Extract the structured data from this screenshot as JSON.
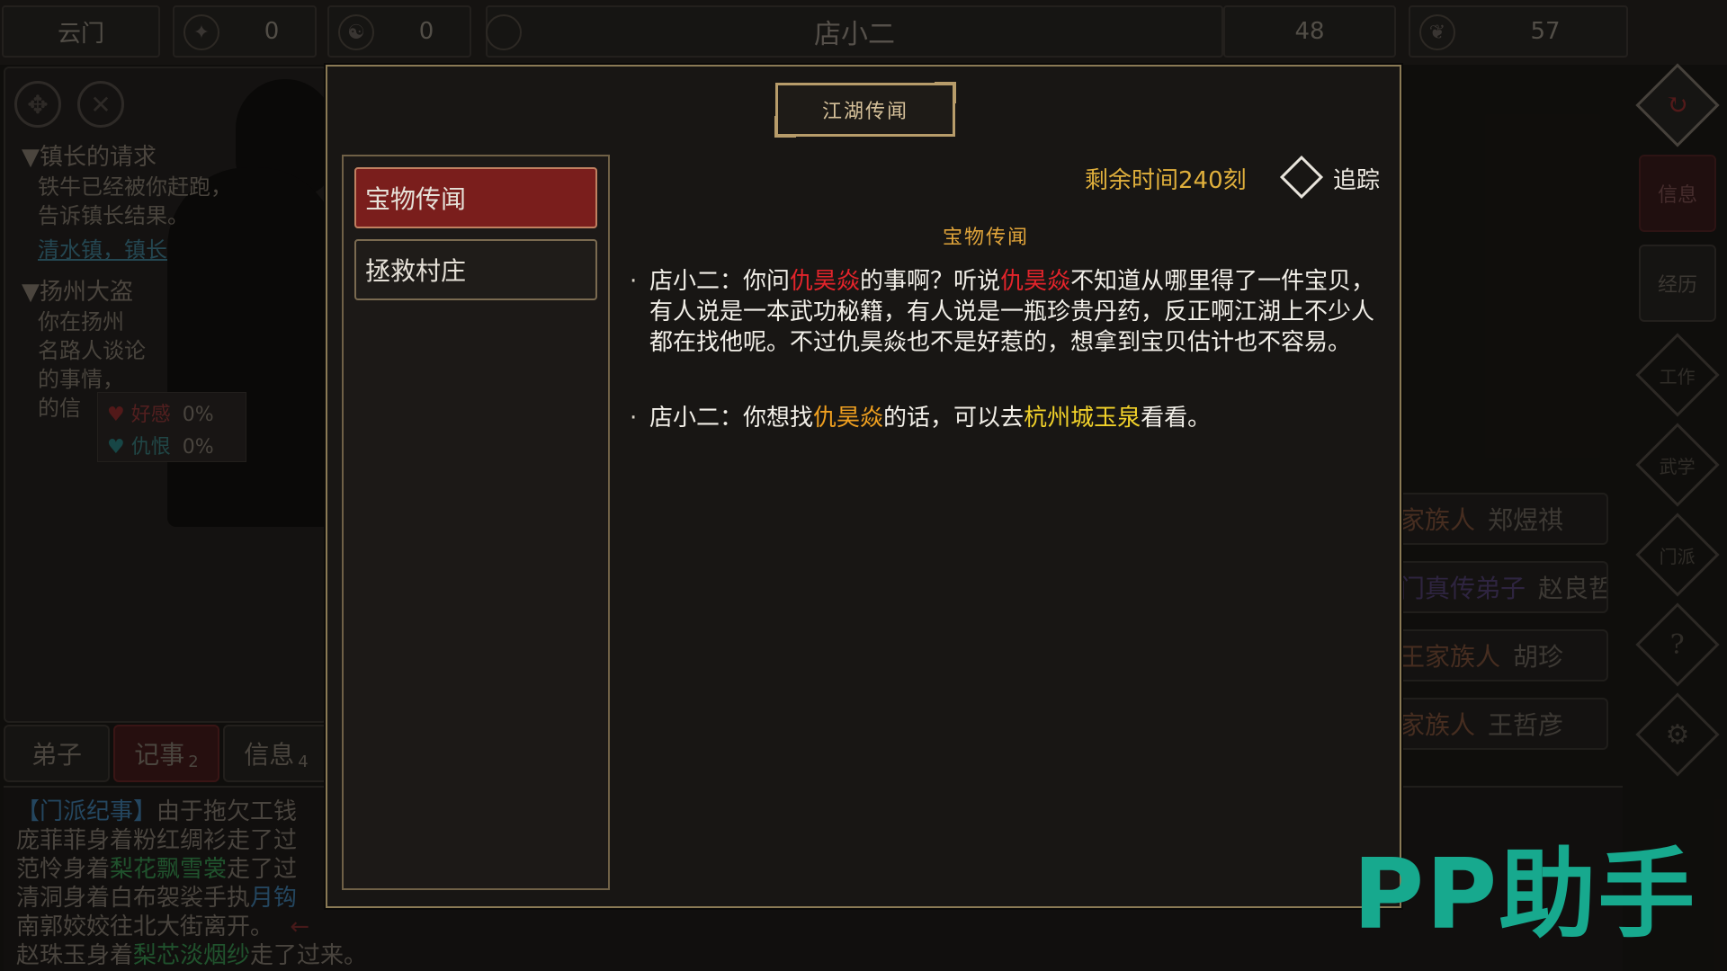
{
  "topbar": {
    "sect_name": "云门",
    "reputation_icon": "声望",
    "reputation": "0",
    "yinyang_icon": "yin-yang",
    "morality": "0",
    "npc_name": "店小二",
    "stat_a": "48",
    "stat_b": "57"
  },
  "left_panel": {
    "quests": [
      {
        "title": "▼镇长的请求",
        "lines": [
          "铁牛已经被你赶跑，",
          "告诉镇长结果。"
        ],
        "link": "清水镇，镇长"
      },
      {
        "title": "▼扬州大盗",
        "lines": [
          "你在扬州",
          "名路人谈论",
          "的事情，",
          "的信"
        ]
      }
    ],
    "affinity_label": "好感",
    "affinity_value": "0%",
    "hatred_label": "仇恨",
    "hatred_value": "0%"
  },
  "bottom_tabs": [
    {
      "label": "弟子",
      "badge": ""
    },
    {
      "label": "记事",
      "badge": "2"
    },
    {
      "label": "信息",
      "badge": "4"
    }
  ],
  "log": {
    "line1_tag": "【门派纪事】",
    "line1_text": "由于拖欠工钱",
    "line2": "庞菲菲身着粉红绸衫走了过",
    "line3_pre": "范怜身着",
    "line3_item": "梨花飘雪裳",
    "line3_post": "走了过",
    "line4_pre": "清洞身着白布袈裟手执",
    "line4_item": "月钩",
    "line5": "南郭姣姣往北大街离开。",
    "line6_pre": "赵珠玉身着",
    "line6_item": "梨芯淡烟纱",
    "line6_post": "走了过来。"
  },
  "right_list": [
    {
      "family": "家族人",
      "name": "郑煜祺",
      "purple": false
    },
    {
      "family": "门真传弟子",
      "name": "赵良哲",
      "purple": true
    },
    {
      "family": "王家族人",
      "name": "胡珍",
      "purple": false
    },
    {
      "family": "家族人",
      "name": "王哲彦",
      "purple": false
    }
  ],
  "side_nav": {
    "info": "信息",
    "experience": "经历",
    "work": "工作",
    "martial": "武学",
    "sect": "门派",
    "help": "?",
    "settings": "⚙"
  },
  "modal": {
    "title": "江湖传闻",
    "quest_tabs": [
      "宝物传闻",
      "拯救村庄"
    ],
    "remaining_time": "剩余时间240刻",
    "track_label": "追踪",
    "content_title": "宝物传闻",
    "entries": [
      {
        "speaker": "店小二：",
        "p1": "你问",
        "n1": "仇昊焱",
        "p2": "的事啊？听说",
        "n2": "仇昊焱",
        "p3": "不知道从哪里得了一件宝贝，有人说是一本武功秘籍，有人说是一瓶珍贵丹药，反正啊江湖上不少人都在找他呢。不过仇昊焱也不是好惹的，想拿到宝贝估计也不容易。"
      },
      {
        "speaker": "店小二：",
        "p1": "你想找",
        "n1": "仇昊焱",
        "p2": "的话，可以去",
        "place": "杭州城玉泉",
        "p3": "看看。"
      }
    ],
    "colors": {
      "npc_name": "#e3242b",
      "target_name": "#f0a020",
      "location": "#f2d22a",
      "timer": "#e0b03c"
    }
  },
  "watermark": "PP助手"
}
